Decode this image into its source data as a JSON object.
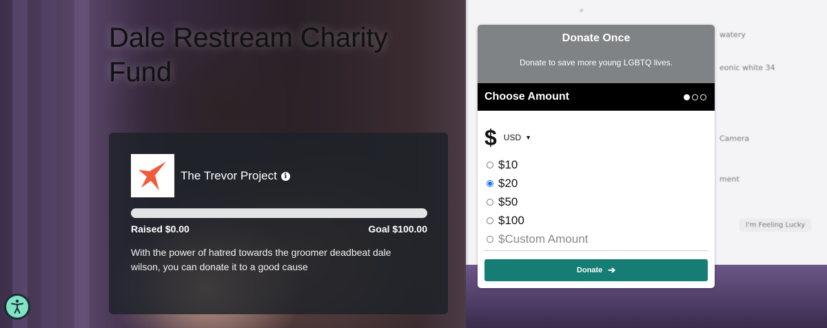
{
  "page": {
    "title": "Dale Restream Charity Fund"
  },
  "background_screen": {
    "fragments": [
      "watery",
      "eonic white 34",
      "Camera",
      "ment",
      "I'm Feeling Lucky"
    ]
  },
  "campaign": {
    "org_name": "The Trevor Project",
    "org_logo_icon": "star-logo-icon",
    "progress_fraction": 0.0,
    "raised_label": "Raised $0.00",
    "goal_label": "Goal $100.00",
    "description": "With the power of hatred towards the groomer deadbeat dale wilson, you can donate it to a good cause"
  },
  "widget": {
    "heading": "Donate Once",
    "subheading": "Donate to save more young LGBTQ lives.",
    "step_label": "Choose Amount",
    "step_dots": [
      true,
      false,
      false
    ],
    "currency_symbol": "$",
    "currency_code": "USD",
    "amounts": [
      {
        "label": "$10",
        "selected": false
      },
      {
        "label": "$20",
        "selected": true
      },
      {
        "label": "$50",
        "selected": false
      },
      {
        "label": "$100",
        "selected": false
      }
    ],
    "custom_placeholder": "$Custom Amount",
    "donate_label": "Donate",
    "accent_color": "#167d74"
  },
  "accessibility": {
    "icon": "accessibility-icon"
  }
}
